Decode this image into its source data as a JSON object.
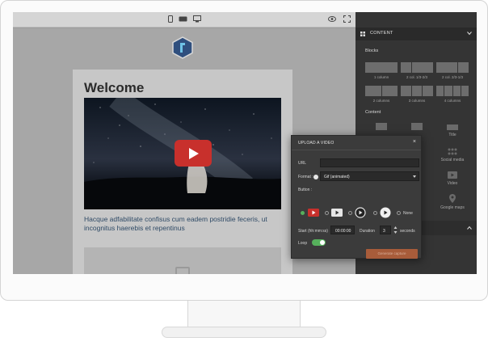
{
  "editor": {
    "panel_header": "CONTENT",
    "blocks_title": "Blocks",
    "blocks": [
      {
        "label": "1 column",
        "cols": 1
      },
      {
        "label": "2 col. 1/3-2/3",
        "cols": 2
      },
      {
        "label": "2 col. 2/3-1/3",
        "cols": 2
      },
      {
        "label": "2 columns",
        "cols": 2
      },
      {
        "label": "3 columns",
        "cols": 3
      },
      {
        "label": "4 columns",
        "cols": 4
      }
    ],
    "content_title": "Content",
    "content_items": [
      {
        "label": "",
        "icon": "image-icon"
      },
      {
        "label": "",
        "icon": "text-icon"
      },
      {
        "label": "Title",
        "icon": "title-icon"
      },
      {
        "label": "Social media",
        "icon": "social-media-icon"
      },
      {
        "label": "Video",
        "icon": "video-icon"
      },
      {
        "label": "Google maps",
        "icon": "map-pin-icon"
      }
    ]
  },
  "email": {
    "title": "Welcome",
    "body": "Hacque adfabilitate confisus cum eadem postridie feceris, ut incognitus haerebis et repentinus"
  },
  "modal": {
    "title": "UPLOAD A VIDEO",
    "close": "×",
    "url_label": "URL",
    "url_value": "",
    "format_label": "Format :",
    "format_value": "Gif (animated)",
    "button_label": "Button :",
    "none_label": "None",
    "start_label": "Start (hh:mm:ss)",
    "start_value": "00:00:00",
    "duration_label": "Duration",
    "duration_value": "3",
    "seconds_label": "seconds",
    "loop_label": "Loop",
    "loop_on": true,
    "generate_label": "Generate capture"
  },
  "colors": {
    "accent_green": "#56b05c",
    "play_red": "#c8302c",
    "generate_button": "#a85c3a",
    "panel_bg": "#343434"
  }
}
